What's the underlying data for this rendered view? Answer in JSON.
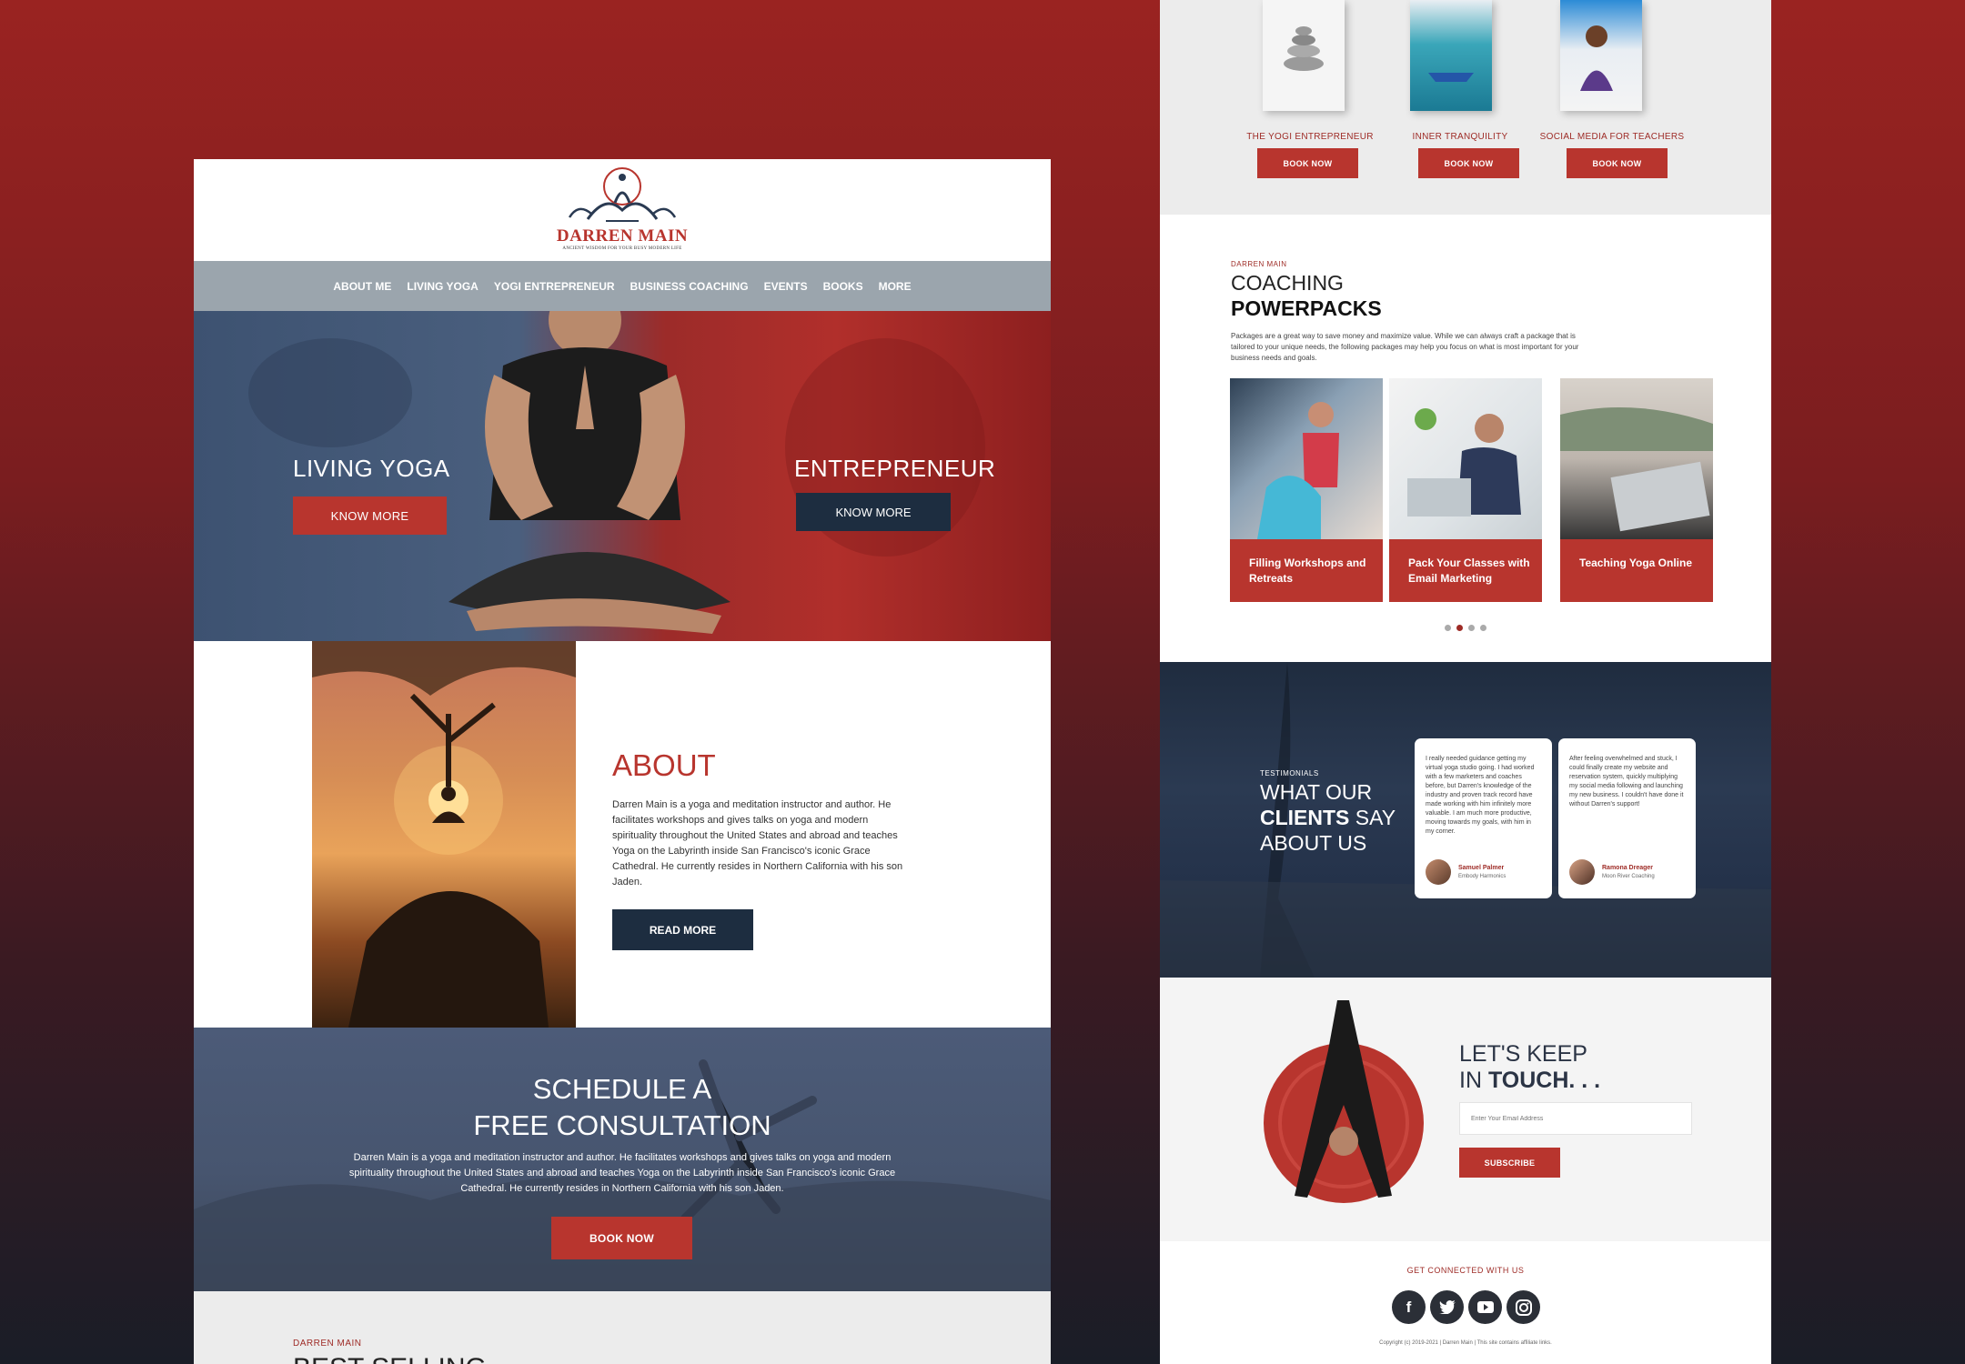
{
  "left": {
    "logo": {
      "name": "DARREN MAIN",
      "tagline": "ANCIENT WISDOM FOR YOUR BUSY MODERN LIFE"
    },
    "nav": [
      "ABOUT ME",
      "LIVING YOGA",
      "YOGI ENTREPRENEUR",
      "BUSINESS COACHING",
      "EVENTS",
      "BOOKS",
      "MORE"
    ],
    "hero": {
      "left_title": "LIVING YOGA",
      "left_button": "KNOW MORE",
      "right_title": "ENTREPRENEUR",
      "right_button": "KNOW MORE"
    },
    "about": {
      "title": "ABOUT",
      "text": "Darren Main is a yoga and meditation instructor and author. He facilitates workshops and gives talks on yoga and modern spirituality throughout the United States and abroad and teaches Yoga on the Labyrinth inside San Francisco's iconic Grace Cathedral. He currently resides in Northern California with his son Jaden.",
      "button": "READ MORE"
    },
    "consult": {
      "title_line1": "SCHEDULE A",
      "title_line2": "FREE CONSULTATION",
      "text": "Darren Main is a yoga and meditation instructor and author. He facilitates workshops and gives talks on yoga and modern spirituality throughout the United States and abroad and teaches Yoga on the Labyrinth inside San Francisco's iconic Grace Cathedral. He currently resides in Northern California with his son Jaden.",
      "button": "BOOK NOW"
    },
    "books_section": {
      "eyebrow": "DARREN MAIN",
      "title": "BEST SELLING"
    }
  },
  "right": {
    "books": [
      {
        "label": "THE YOGI ENTREPRENEUR",
        "button": "BOOK NOW",
        "color": "#f2f2f2"
      },
      {
        "label": "INNER TRANQUILITY",
        "button": "BOOK NOW",
        "color": "#3aa6b9"
      },
      {
        "label": "SOCIAL MEDIA FOR TEACHERS",
        "button": "BOOK NOW",
        "color": "#2c8bd6"
      }
    ],
    "coaching": {
      "eyebrow": "DARREN MAIN",
      "title_line1": "COACHING",
      "title_line2": "POWERPACKS",
      "text": "Packages are a great way to save money and maximize value. While we can always craft a package that is tailored to your unique needs, the following packages may help you focus on what is most important for your business needs and goals.",
      "cards": [
        "Filling Workshops and Retreats",
        "Pack Your Classes with Email Marketing",
        "Teaching Yoga Online"
      ]
    },
    "testimonials": {
      "eyebrow": "TESTIMONIALS",
      "title_line1": "WHAT OUR",
      "title_bold": "CLIENTS",
      "title_line2_rest": " SAY",
      "title_line3": "ABOUT US",
      "items": [
        {
          "quote": "I really needed guidance getting my virtual yoga studio going. I had worked with a few marketers and coaches before, but Darren's knowledge of the industry and proven track record have made working with him infinitely more valuable. I am much more productive, moving towards my goals, with him in my corner.",
          "name": "Samuel Palmer",
          "company": "Embody Harmonics"
        },
        {
          "quote": "After feeling overwhelmed and stuck, I could finally create my website and reservation system, quickly multiplying my social media following and launching my new business. I couldn't have done it without Darren's support!",
          "name": "Ramona Dreager",
          "company": "Moon River Coaching"
        }
      ]
    },
    "touch": {
      "title_line1": "LET'S KEEP",
      "title_in": "IN ",
      "title_bold": "TOUCH. . .",
      "placeholder": "Enter Your Email Address",
      "button": "SUBSCRIBE"
    },
    "footer": {
      "heading": "GET CONNECTED WITH US",
      "copyright": "Copyright (c) 2019-2021 | Darren Main | This site contains affiliate links."
    }
  }
}
